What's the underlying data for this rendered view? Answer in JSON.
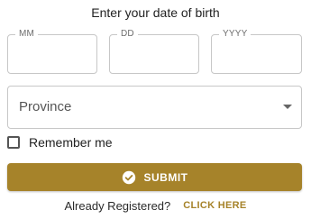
{
  "form": {
    "title": "Enter your date of birth",
    "dob": {
      "month_label": "MM",
      "day_label": "DD",
      "year_label": "YYYY",
      "month_value": "",
      "day_value": "",
      "year_value": ""
    },
    "province": {
      "placeholder": "Province",
      "selected": ""
    },
    "remember": {
      "label": "Remember me",
      "checked": false
    },
    "submit_label": "SUBMIT",
    "already_registered": "Already Registered?",
    "click_here": "CLICK HERE"
  },
  "colors": {
    "accent": "#a6832a",
    "border": "#c7c7c7"
  },
  "icons": {
    "submit": "check-circle-icon",
    "dropdown": "chevron-down-icon"
  }
}
